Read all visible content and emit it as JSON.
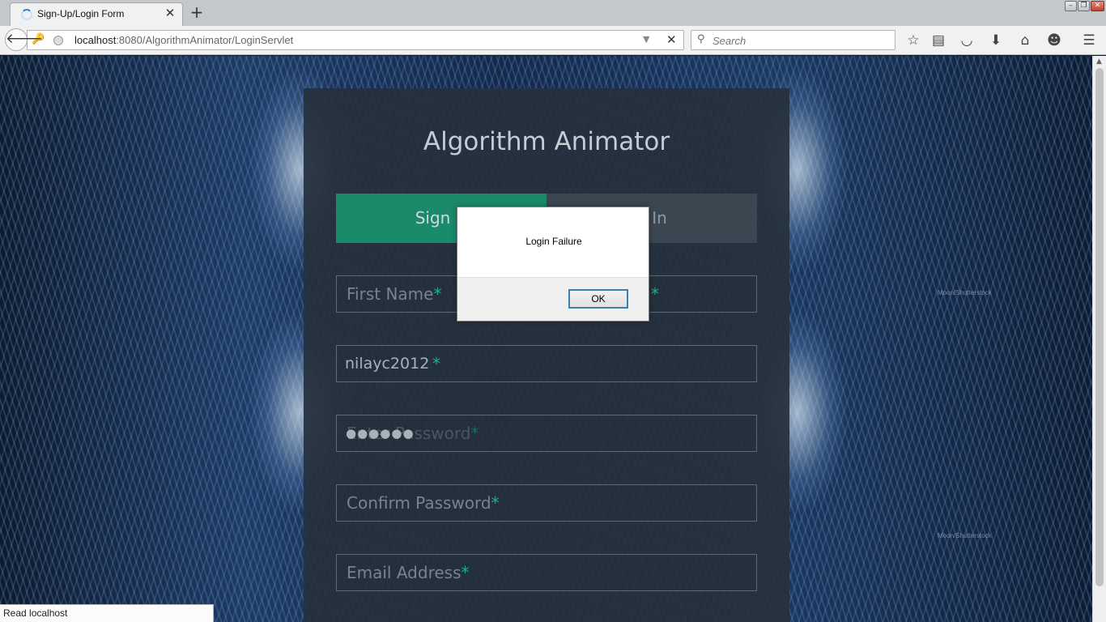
{
  "browser": {
    "tab": {
      "title": "Sign-Up/Login Form"
    },
    "new_tab_glyph": "+",
    "address": {
      "host": "localhost",
      "rest": ":8080/AlgorithmAnimator/LoginServlet"
    },
    "search": {
      "placeholder": "Search"
    },
    "toolbar_icons": [
      "bookmark-star-icon",
      "reading-list-icon",
      "pocket-icon",
      "download-icon",
      "home-icon",
      "chat-icon",
      "menu-icon"
    ],
    "status": "Read localhost"
  },
  "page": {
    "title": "Algorithm Animator",
    "tabs": {
      "signup": "Sign U",
      "login": "g In"
    },
    "fields": {
      "first_name": {
        "placeholder": "First Name",
        "required": "*"
      },
      "last_name_required": "*",
      "username": {
        "value": "nilayc2012",
        "required": "*"
      },
      "password": {
        "placeholder": "Enter Password",
        "value_masked": "●●●●●●",
        "required": "*"
      },
      "confirm_password": {
        "placeholder": "Confirm Password",
        "required": "*"
      },
      "email": {
        "placeholder": "Email Address",
        "required": "*"
      }
    },
    "watermark": "Moon/Shutterstock"
  },
  "dialog": {
    "message": "Login Failure",
    "ok_label": "OK"
  },
  "colors": {
    "accent_green": "#1ab188",
    "signup_tab_bg": "#1a8a6b",
    "panel_bg": "#26303c",
    "dialog_focus_border": "#3c7fb1"
  }
}
